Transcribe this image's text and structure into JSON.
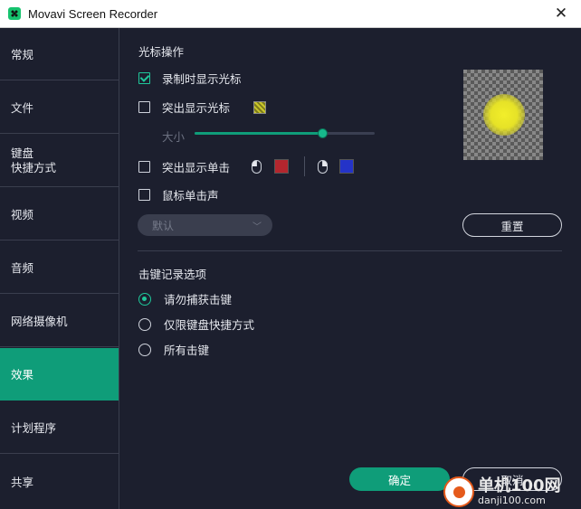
{
  "window": {
    "title": "Movavi Screen Recorder",
    "close_glyph": "✕"
  },
  "sidebar": {
    "items": [
      {
        "label": "常规"
      },
      {
        "label": "文件"
      },
      {
        "label": "键盘",
        "label2": "快捷方式"
      },
      {
        "label": "视频"
      },
      {
        "label": "音频"
      },
      {
        "label": "网络摄像机"
      },
      {
        "label": "效果",
        "active": true
      },
      {
        "label": "计划程序"
      },
      {
        "label": "共享"
      }
    ]
  },
  "cursor": {
    "section_title": "光标操作",
    "show_cursor": {
      "label": "录制时显示光标",
      "checked": true
    },
    "highlight_cursor": {
      "label": "突出显示光标",
      "checked": false
    },
    "size": {
      "label": "大小",
      "value_fraction": 0.71
    },
    "highlight_clicks": {
      "label": "突出显示单击",
      "checked": false,
      "left_color": "#b3262e",
      "right_color": "#2433c8"
    },
    "click_sound": {
      "label": "鼠标单击声",
      "checked": false
    },
    "sound_select": {
      "value": "默认"
    },
    "reset_label": "重置"
  },
  "keystrokes": {
    "section_title": "击键记录选项",
    "options": [
      {
        "label": "请勿捕获击键",
        "selected": true
      },
      {
        "label": "仅限键盘快捷方式",
        "selected": false
      },
      {
        "label": "所有击键",
        "selected": false
      }
    ]
  },
  "footer": {
    "ok_label": "确定",
    "cancel_label": "取消"
  },
  "watermark": {
    "title": "单机100网",
    "url": "danji100.com"
  },
  "colors": {
    "accent": "#0f9d79",
    "background": "#1c1f2e"
  }
}
